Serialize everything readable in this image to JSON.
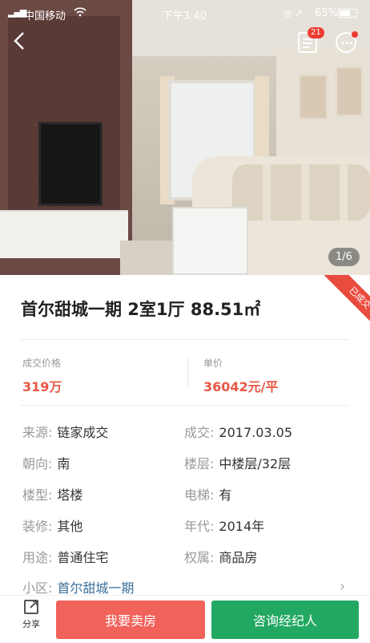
{
  "status_bar": {
    "carrier": "中国移动",
    "time": "下午3:40",
    "battery_percent": "65%",
    "battery_level": 0.65
  },
  "header": {
    "list_badge_count": "21"
  },
  "gallery": {
    "counter": "1/6"
  },
  "listing": {
    "sold_ribbon": "已成交",
    "title": "首尔甜城一期 2室1厅 88.51㎡",
    "deal_price_label": "成交价格",
    "deal_price_value": "319万",
    "unit_price_label": "单价",
    "unit_price_value": "36042元/平"
  },
  "details": [
    {
      "key": "来源:",
      "value": "链家成交"
    },
    {
      "key": "成交:",
      "value": "2017.03.05"
    },
    {
      "key": "朝向:",
      "value": "南"
    },
    {
      "key": "楼层:",
      "value": "中楼层/32层"
    },
    {
      "key": "楼型:",
      "value": "塔楼"
    },
    {
      "key": "电梯:",
      "value": "有"
    },
    {
      "key": "装修:",
      "value": "其他"
    },
    {
      "key": "年代:",
      "value": "2014年"
    },
    {
      "key": "用途:",
      "value": "普通住宅"
    },
    {
      "key": "权属:",
      "value": "商品房"
    }
  ],
  "community": {
    "key": "小区:",
    "value": "首尔甜城一期"
  },
  "bottom_bar": {
    "share_label": "分享",
    "sell_button": "我要卖房",
    "consult_button": "咨询经纪人"
  },
  "colors": {
    "accent_red": "#e65945",
    "sell_button": "#f0625a",
    "consult_button": "#23a862",
    "link_blue": "#3d6f9a"
  }
}
